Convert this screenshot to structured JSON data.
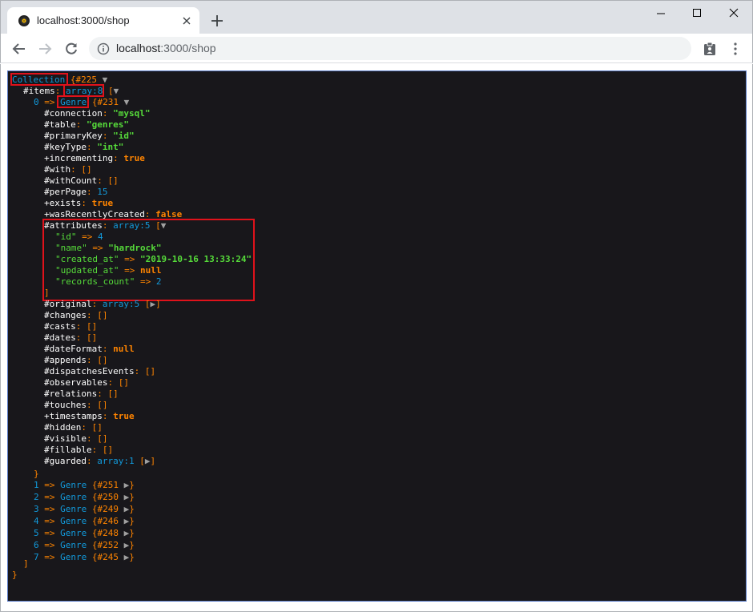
{
  "browser": {
    "tab_title": "localhost:3000/shop",
    "url_host": "localhost",
    "url_path": ":3000/shop"
  },
  "dump": {
    "root_class": "Collection",
    "root_id": "{#225",
    "items_label": "#items",
    "items_type": "array:8",
    "item0": {
      "index": "0",
      "class": "Genre",
      "id": "{#231",
      "props": [
        {
          "name": "#connection",
          "value": "\"mysql\"",
          "kind": "str"
        },
        {
          "name": "#table",
          "value": "\"genres\"",
          "kind": "str"
        },
        {
          "name": "#primaryKey",
          "value": "\"id\"",
          "kind": "str"
        },
        {
          "name": "#keyType",
          "value": "\"int\"",
          "kind": "str"
        },
        {
          "name": "+incrementing",
          "value": "true",
          "kind": "const"
        },
        {
          "name": "#with",
          "value": "[]",
          "kind": "punc"
        },
        {
          "name": "#withCount",
          "value": "[]",
          "kind": "punc"
        },
        {
          "name": "#perPage",
          "value": "15",
          "kind": "num"
        },
        {
          "name": "+exists",
          "value": "true",
          "kind": "const"
        },
        {
          "name": "+wasRecentlyCreated",
          "value": "false",
          "kind": "const"
        }
      ],
      "attributes_label": "#attributes",
      "attributes_type": "array:5",
      "attributes": [
        {
          "key": "\"id\"",
          "value": "4",
          "kind": "num"
        },
        {
          "key": "\"name\"",
          "value": "\"hardrock\"",
          "kind": "str"
        },
        {
          "key": "\"created_at\"",
          "value": "\"2019-10-16 13:33:24\"",
          "kind": "str"
        },
        {
          "key": "\"updated_at\"",
          "value": "null",
          "kind": "const"
        },
        {
          "key": "\"records_count\"",
          "value": "2",
          "kind": "num"
        }
      ],
      "props2": [
        {
          "name": "#original",
          "value": "array:5",
          "kind": "arr"
        },
        {
          "name": "#changes",
          "value": "[]",
          "kind": "punc"
        },
        {
          "name": "#casts",
          "value": "[]",
          "kind": "punc"
        },
        {
          "name": "#dates",
          "value": "[]",
          "kind": "punc"
        },
        {
          "name": "#dateFormat",
          "value": "null",
          "kind": "const"
        },
        {
          "name": "#appends",
          "value": "[]",
          "kind": "punc"
        },
        {
          "name": "#dispatchesEvents",
          "value": "[]",
          "kind": "punc"
        },
        {
          "name": "#observables",
          "value": "[]",
          "kind": "punc"
        },
        {
          "name": "#relations",
          "value": "[]",
          "kind": "punc"
        },
        {
          "name": "#touches",
          "value": "[]",
          "kind": "punc"
        },
        {
          "name": "+timestamps",
          "value": "true",
          "kind": "const"
        },
        {
          "name": "#hidden",
          "value": "[]",
          "kind": "punc"
        },
        {
          "name": "#visible",
          "value": "[]",
          "kind": "punc"
        },
        {
          "name": "#fillable",
          "value": "[]",
          "kind": "punc"
        },
        {
          "name": "#guarded",
          "value": "array:1",
          "kind": "arr"
        }
      ]
    },
    "collapsed_items": [
      {
        "index": "1",
        "class": "Genre",
        "id": "{#251"
      },
      {
        "index": "2",
        "class": "Genre",
        "id": "{#250"
      },
      {
        "index": "3",
        "class": "Genre",
        "id": "{#249"
      },
      {
        "index": "4",
        "class": "Genre",
        "id": "{#246"
      },
      {
        "index": "5",
        "class": "Genre",
        "id": "{#248"
      },
      {
        "index": "6",
        "class": "Genre",
        "id": "{#252"
      },
      {
        "index": "7",
        "class": "Genre",
        "id": "{#245"
      }
    ]
  },
  "colors": {
    "highlight": "#e0121b",
    "string": "#56db3a",
    "note": "#1299da",
    "constant": "#ff8400"
  }
}
